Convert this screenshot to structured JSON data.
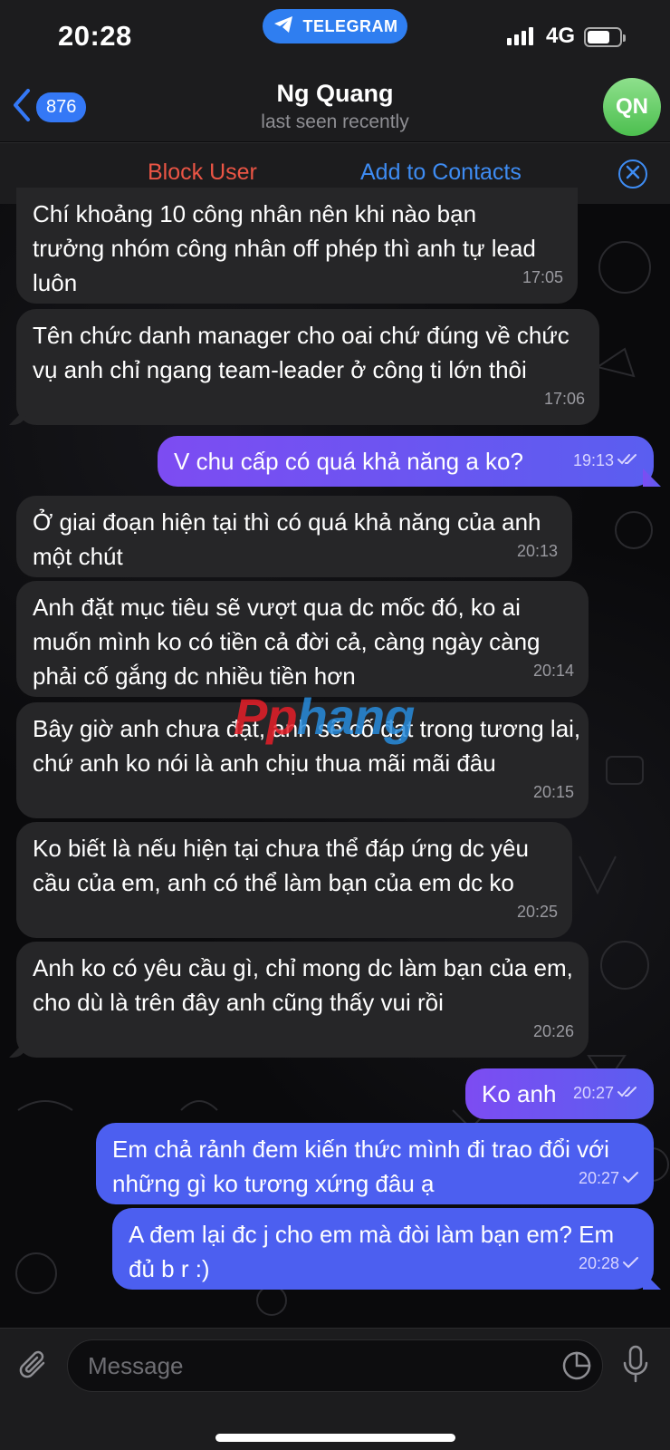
{
  "status_bar": {
    "time": "20:28",
    "app_pill": "TELEGRAM",
    "network": "4G"
  },
  "header": {
    "back_count": "876",
    "title": "Ng Quang",
    "subtitle": "last seen recently",
    "avatar_initials": "QN"
  },
  "action_bar": {
    "block_label": "Block User",
    "add_label": "Add to Contacts"
  },
  "messages": [
    {
      "dir": "in",
      "text": "Chí khoảng 10 công nhân nên khi nào bạn trưởng nhóm công nhân off phép thì anh tự lead luôn",
      "time": "17:05"
    },
    {
      "dir": "in",
      "text": "Tên chức danh manager cho oai chứ đúng về chức vụ anh chỉ ngang team-leader ở công ti lớn thôi",
      "time": "17:06"
    },
    {
      "dir": "out",
      "text": "V chu cấp có quá khả năng a ko?",
      "time": "19:13",
      "read": true
    },
    {
      "dir": "in",
      "text": "Ở giai đoạn hiện tại thì có quá khả năng của anh một chút",
      "time": "20:13"
    },
    {
      "dir": "in",
      "text": "Anh đặt mục tiêu sẽ vượt qua dc mốc đó, ko ai muốn mình ko có tiền cả đời cả, càng ngày càng phải cố gắng dc nhiều tiền hơn",
      "time": "20:14"
    },
    {
      "dir": "in",
      "text": "Bây giờ anh chưa đạt, anh sẽ cố đạt trong tương lai, chứ anh ko nói là anh chịu thua mãi mãi đâu",
      "time": "20:15"
    },
    {
      "dir": "in",
      "text": "Ko biết là nếu hiện tại chưa thể đáp ứng dc yêu cầu của em, anh có thể làm bạn của em dc ko",
      "time": "20:25"
    },
    {
      "dir": "in",
      "text": "Anh ko có yêu cầu gì, chỉ mong dc làm bạn của em, cho dù là trên đây anh cũng thấy vui rồi",
      "time": "20:26"
    },
    {
      "dir": "out",
      "text": "Ko anh",
      "time": "20:27",
      "read": true
    },
    {
      "dir": "out",
      "text": "Em chả rảnh đem kiến thức mình đi trao đổi với những gì ko tương xứng đâu ạ",
      "time": "20:27",
      "read": false
    },
    {
      "dir": "out",
      "text": "A đem lại đc j cho em mà đòi làm bạn em? Em đủ b r :)",
      "time": "20:28",
      "read": false
    }
  ],
  "watermark": {
    "part1": "Pp",
    "part2": "hang"
  },
  "input": {
    "placeholder": "Message"
  },
  "colors": {
    "accent_blue": "#3e8cf3",
    "block_red": "#eb5545",
    "out_bubble_purple": "#7d4cf2",
    "out_bubble_blue": "#4c5ff0",
    "in_bubble": "#262628"
  },
  "icons": [
    "telegram-icon",
    "signal-icon",
    "battery-icon",
    "back-chevron-icon",
    "close-icon",
    "double-check-icon",
    "check-icon",
    "paperclip-icon",
    "sticker-icon",
    "microphone-icon"
  ]
}
